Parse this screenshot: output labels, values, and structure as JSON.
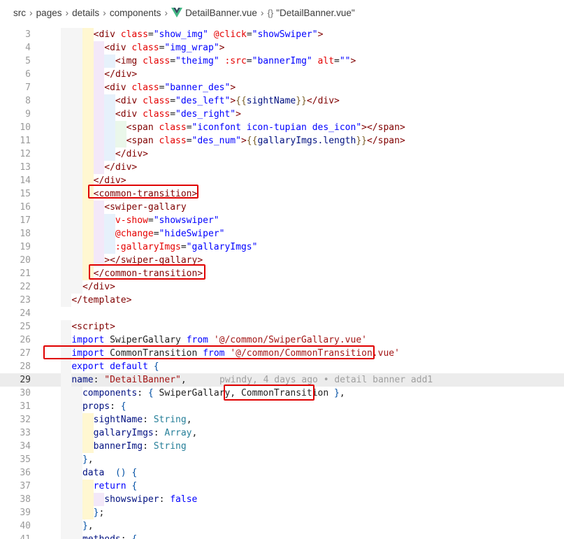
{
  "breadcrumb": {
    "items": [
      "src",
      "pages",
      "details",
      "components",
      "DetailBanner.vue",
      "\"DetailBanner.vue\""
    ]
  },
  "editor": {
    "blame": "pwindy, 4 days ago • detail banner add1",
    "lines": [
      {
        "n": "3",
        "text": "<div class=\"show_img\" @click=\"showSwiper\">"
      },
      {
        "n": "4",
        "text": "<div class=\"img_wrap\">"
      },
      {
        "n": "5",
        "text": "<img class=\"theimg\" :src=\"bannerImg\" alt=\"\">"
      },
      {
        "n": "6",
        "text": "</div>"
      },
      {
        "n": "7",
        "text": "<div class=\"banner_des\">"
      },
      {
        "n": "8",
        "text": "<div class=\"des_left\">{{sightName}}</div>"
      },
      {
        "n": "9",
        "text": "<div class=\"des_right\">"
      },
      {
        "n": "10",
        "text": "<span class=\"iconfont icon-tupian des_icon\"></span>"
      },
      {
        "n": "11",
        "text": "<span class=\"des_num\">{{gallaryImgs.length}}</span>"
      },
      {
        "n": "12",
        "text": "</div>"
      },
      {
        "n": "13",
        "text": "</div>"
      },
      {
        "n": "14",
        "text": "</div>"
      },
      {
        "n": "15",
        "text": "<common-transition>"
      },
      {
        "n": "16",
        "text": "<swiper-gallary"
      },
      {
        "n": "17",
        "text": "v-show=\"showswiper\""
      },
      {
        "n": "18",
        "text": "@change=\"hideSwiper\""
      },
      {
        "n": "19",
        "text": ":gallaryImgs=\"gallaryImgs\""
      },
      {
        "n": "20",
        "text": "></swiper-gallary>"
      },
      {
        "n": "21",
        "text": "</common-transition>"
      },
      {
        "n": "22",
        "text": "</div>"
      },
      {
        "n": "23",
        "text": "</template>"
      },
      {
        "n": "24",
        "text": ""
      },
      {
        "n": "25",
        "text": "<script>"
      },
      {
        "n": "26",
        "text": "import SwiperGallary from '@/common/SwiperGallary.vue'"
      },
      {
        "n": "27",
        "text": "import CommonTransition from '@/common/CommonTransition.vue'"
      },
      {
        "n": "28",
        "text": "export default {"
      },
      {
        "n": "29",
        "text": "name: \"DetailBanner\","
      },
      {
        "n": "30",
        "text": "components: { SwiperGallary, CommonTransition },"
      },
      {
        "n": "31",
        "text": "props: {"
      },
      {
        "n": "32",
        "text": "sightName: String,"
      },
      {
        "n": "33",
        "text": "gallaryImgs: Array,"
      },
      {
        "n": "34",
        "text": "bannerImg: String"
      },
      {
        "n": "35",
        "text": "},"
      },
      {
        "n": "36",
        "text": "data  () {"
      },
      {
        "n": "37",
        "text": "return {"
      },
      {
        "n": "38",
        "text": "showswiper: false"
      },
      {
        "n": "39",
        "text": "};"
      },
      {
        "n": "40",
        "text": "},"
      },
      {
        "n": "41",
        "text": "methods: {"
      }
    ]
  },
  "colors": {
    "tag": "#800000",
    "attribute": "#e50000",
    "string": "#0000ff",
    "keyword": "#0000ff",
    "highlight_box": "#e00000",
    "current_line": "#ececec"
  }
}
